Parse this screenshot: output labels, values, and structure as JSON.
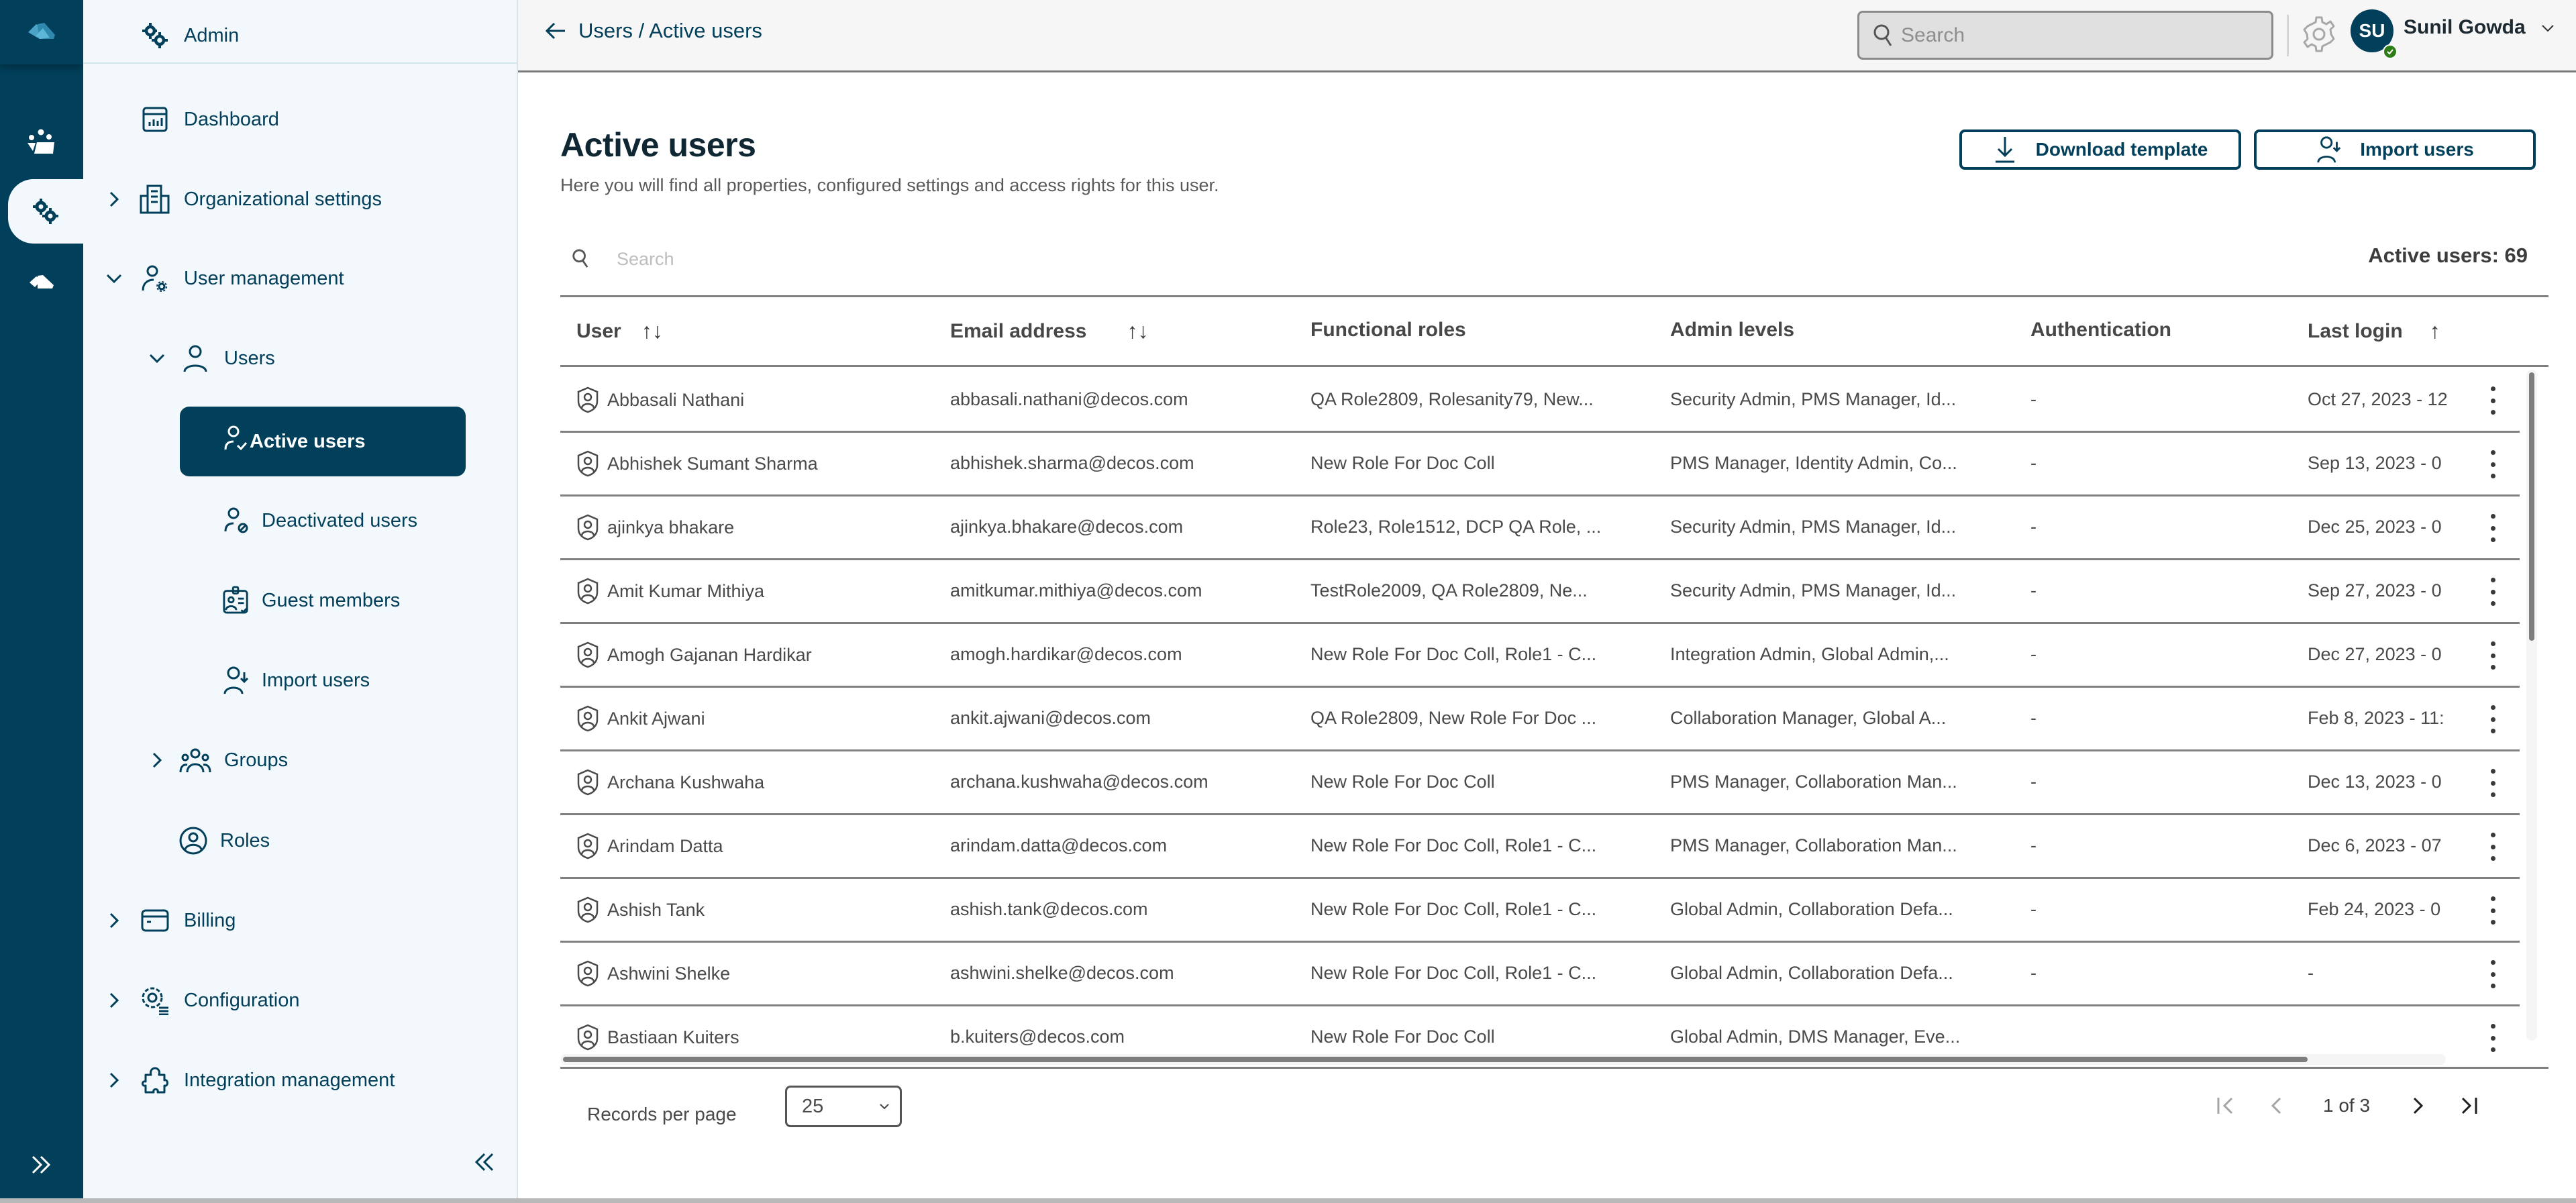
{
  "rail": {
    "items": [
      {
        "name": "apps",
        "icon": "team-icon"
      },
      {
        "name": "admin",
        "icon": "gears-icon",
        "active": true
      },
      {
        "name": "other",
        "icon": "logo-small-icon"
      }
    ],
    "expand_icon": "double-chevron-right-icon"
  },
  "sidebar": {
    "header": {
      "label": "Admin",
      "icon": "gears-icon"
    },
    "items": [
      {
        "label": "Dashboard",
        "icon": "dashboard-icon",
        "level": 0,
        "expandable": false
      },
      {
        "label": "Organizational settings",
        "icon": "building-icon",
        "level": 0,
        "expandable": true,
        "expanded": false
      },
      {
        "label": "User management",
        "icon": "user-gear-icon",
        "level": 0,
        "expandable": true,
        "expanded": true
      },
      {
        "label": "Users",
        "icon": "user-icon",
        "level": 1,
        "expandable": true,
        "expanded": true
      },
      {
        "label": "Active users",
        "icon": "user-check-icon",
        "level": 2,
        "active": true
      },
      {
        "label": "Deactivated users",
        "icon": "user-blocked-icon",
        "level": 2
      },
      {
        "label": "Guest members",
        "icon": "guest-badge-icon",
        "level": 2
      },
      {
        "label": "Import users",
        "icon": "user-import-icon",
        "level": 2
      },
      {
        "label": "Groups",
        "icon": "group-icon",
        "level": 1,
        "expandable": true,
        "expanded": false
      },
      {
        "label": "Roles",
        "icon": "role-icon",
        "level": 1,
        "expandable": false
      },
      {
        "label": "Billing",
        "icon": "billing-icon",
        "level": 0,
        "expandable": true,
        "expanded": false
      },
      {
        "label": "Configuration",
        "icon": "config-icon",
        "level": 0,
        "expandable": true,
        "expanded": false
      },
      {
        "label": "Integration management",
        "icon": "puzzle-icon",
        "level": 0,
        "expandable": true,
        "expanded": false
      }
    ],
    "collapse_icon": "double-chevron-left-icon"
  },
  "topbar": {
    "breadcrumb": "Users / Active users",
    "search_placeholder": "Search",
    "search_value": "",
    "user": {
      "initials": "SU",
      "name": "Sunil Gowda",
      "status": "online"
    }
  },
  "page": {
    "title": "Active users",
    "subtitle": "Here you will find all properties, configured settings and access rights for this user.",
    "download_template_label": "Download template",
    "import_users_label": "Import users",
    "table_search_placeholder": "Search",
    "table_search_value": "",
    "active_count_label": "Active users: 69"
  },
  "table": {
    "columns": [
      {
        "label": "User",
        "sort": "both"
      },
      {
        "label": "Email address",
        "sort": "both"
      },
      {
        "label": "Functional roles"
      },
      {
        "label": "Admin levels"
      },
      {
        "label": "Authentication"
      },
      {
        "label": "Last login",
        "sort": "asc"
      }
    ],
    "rows": [
      {
        "user": "Abbasali Nathani",
        "email": "abbasali.nathani@decos.com",
        "roles": "QA Role2809, Rolesanity79, New...",
        "admin": "Security Admin, PMS Manager, Id...",
        "auth": "-",
        "last_login": "Oct 27, 2023 - 12"
      },
      {
        "user": "Abhishek Sumant Sharma",
        "email": "abhishek.sharma@decos.com",
        "roles": "New Role For Doc Coll",
        "admin": "PMS Manager, Identity Admin, Co...",
        "auth": "-",
        "last_login": "Sep 13, 2023 - 0"
      },
      {
        "user": "ajinkya bhakare",
        "email": "ajinkya.bhakare@decos.com",
        "roles": "Role23, Role1512, DCP QA Role, ...",
        "admin": "Security Admin, PMS Manager, Id...",
        "auth": "-",
        "last_login": "Dec 25, 2023 - 0"
      },
      {
        "user": "Amit Kumar Mithiya",
        "email": "amitkumar.mithiya@decos.com",
        "roles": "TestRole2009, QA Role2809, Ne...",
        "admin": "Security Admin, PMS Manager, Id...",
        "auth": "-",
        "last_login": "Sep 27, 2023 - 0"
      },
      {
        "user": "Amogh Gajanan Hardikar",
        "email": "amogh.hardikar@decos.com",
        "roles": "New Role For Doc Coll, Role1 - C...",
        "admin": "Integration Admin, Global Admin,...",
        "auth": "-",
        "last_login": "Dec 27, 2023 - 0"
      },
      {
        "user": "Ankit Ajwani",
        "email": "ankit.ajwani@decos.com",
        "roles": "QA Role2809, New Role For Doc ...",
        "admin": "Collaboration Manager, Global A...",
        "auth": "-",
        "last_login": "Feb 8, 2023 - 11:"
      },
      {
        "user": "Archana  Kushwaha",
        "email": "archana.kushwaha@decos.com",
        "roles": "New Role For Doc Coll",
        "admin": "PMS Manager, Collaboration Man...",
        "auth": "-",
        "last_login": "Dec 13, 2023 - 0"
      },
      {
        "user": "Arindam Datta",
        "email": "arindam.datta@decos.com",
        "roles": "New Role For Doc Coll, Role1 - C...",
        "admin": "PMS Manager, Collaboration Man...",
        "auth": "-",
        "last_login": "Dec 6, 2023 - 07"
      },
      {
        "user": "Ashish Tank",
        "email": "ashish.tank@decos.com",
        "roles": "New Role For Doc Coll, Role1 - C...",
        "admin": "Global Admin, Collaboration Defa...",
        "auth": "-",
        "last_login": "Feb 24, 2023 - 0"
      },
      {
        "user": "Ashwini Shelke",
        "email": "ashwini.shelke@decos.com",
        "roles": "New Role For Doc Coll, Role1 - C...",
        "admin": "Global Admin, Collaboration Defa...",
        "auth": "-",
        "last_login": "-"
      },
      {
        "user": "Bastiaan Kuiters",
        "email": "b.kuiters@decos.com",
        "roles": "New Role For Doc Coll",
        "admin": "Global Admin, DMS Manager, Eve...",
        "auth": "",
        "last_login": ""
      }
    ]
  },
  "pagination": {
    "records_per_page_label": "Records per page",
    "records_per_page_value": "25",
    "page_text": "1 of 3",
    "current_page": 1,
    "total_pages": 3
  }
}
